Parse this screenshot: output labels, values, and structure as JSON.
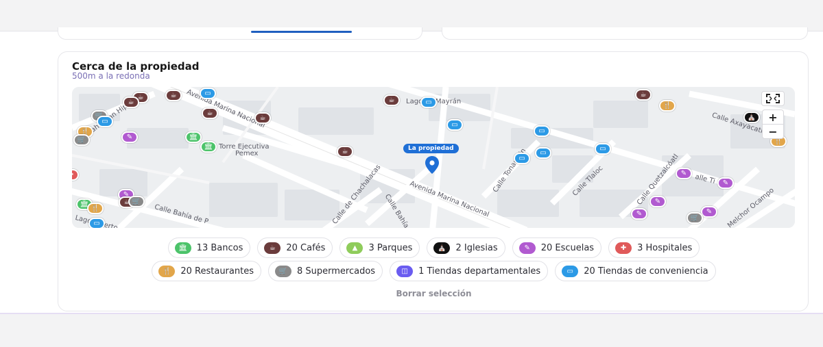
{
  "section": {
    "title": "Cerca de la propiedad",
    "subtitle": "500m a la redonda"
  },
  "map": {
    "property_label": "La propiedad",
    "streets": [
      "Avenida Marina Nacional",
      "Avenida Marina Nacional",
      "Calle Bahía de P",
      "Calle Bahía la",
      "Calle de Chachalacas",
      "Calle Tonantzin",
      "Calle Tlaloc",
      "Calle Quetzalcóatl",
      "Melchor Ocampo",
      "Calle Axayacatl",
      "Lago de Mayrán",
      "Torre Ejecutiva",
      "Pemex",
      "Lago Alberto",
      "Bahía San Hipólito",
      "alle Ti"
    ],
    "controls": {
      "fullscreen_icon": "fullscreen-icon",
      "zoom_in": "+",
      "zoom_out": "−"
    }
  },
  "categories": [
    {
      "label": "13 Bancos",
      "icon": "bank-icon",
      "color": "#4cc36a",
      "glyph": "🏛"
    },
    {
      "label": "20 Cafés",
      "icon": "coffee-icon",
      "color": "#6b3c3c",
      "glyph": "☕"
    },
    {
      "label": "3 Parques",
      "icon": "park-icon",
      "color": "#8fcc5b",
      "glyph": "▲"
    },
    {
      "label": "2 Iglesias",
      "icon": "church-icon",
      "color": "#111111",
      "glyph": "⛪"
    },
    {
      "label": "20 Escuelas",
      "icon": "school-icon",
      "color": "#b15ad0",
      "glyph": "✎"
    },
    {
      "label": "3 Hospitales",
      "icon": "hospital-icon",
      "color": "#e05a5a",
      "glyph": "✚"
    },
    {
      "label": "20 Restaurantes",
      "icon": "restaurant-icon",
      "color": "#e2a64a",
      "glyph": "🍴"
    },
    {
      "label": "8 Supermercados",
      "icon": "cart-icon",
      "color": "#8a8a8a",
      "glyph": "🛒"
    },
    {
      "label": "1 Tiendas departamentales",
      "icon": "bag-icon",
      "color": "#6a5cf0",
      "glyph": "◫"
    },
    {
      "label": "20 Tiendas de conveniencia",
      "icon": "store-icon",
      "color": "#2c9ae6",
      "glyph": "▭"
    }
  ],
  "clear_selection": "Borrar selección",
  "colors": {
    "accent": "#1f6fd6",
    "subtitle": "#7a6fb5",
    "card_border": "#e6e6ea"
  }
}
